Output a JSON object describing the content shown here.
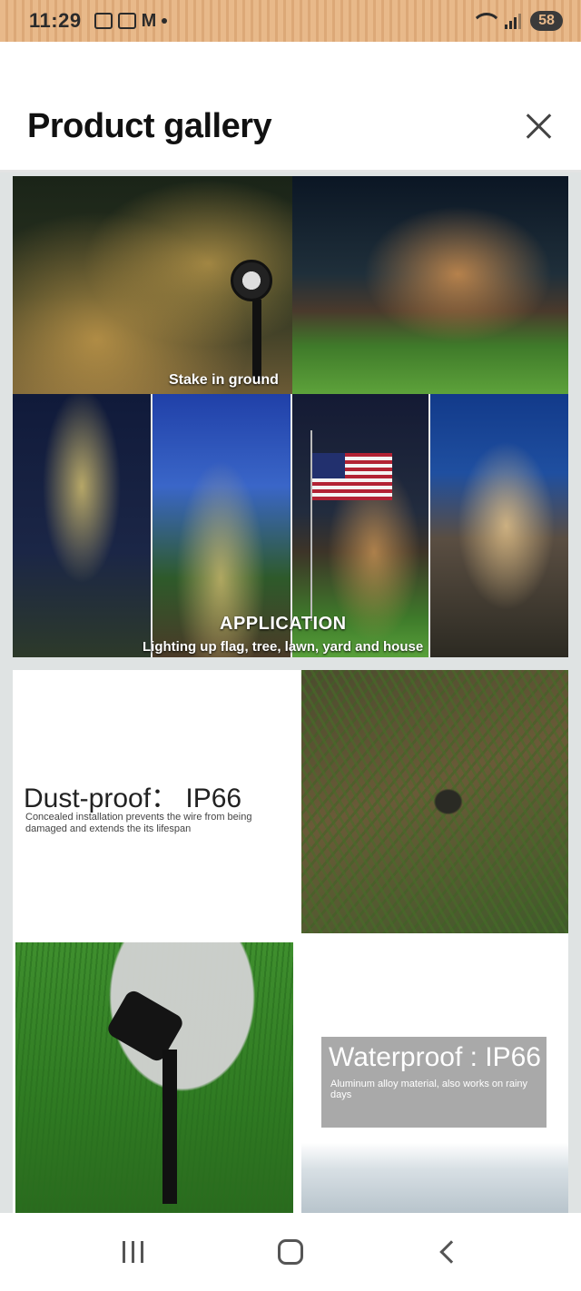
{
  "status_bar": {
    "time": "11:29",
    "mail_glyph": "M",
    "battery": "58",
    "icons": [
      "screenshot-icon",
      "pdf-icon",
      "gmail-icon",
      "dot-icon",
      "wifi-icon",
      "signal-icon",
      "battery-icon"
    ]
  },
  "header": {
    "title": "Product gallery",
    "close_icon": "close-icon"
  },
  "gallery": {
    "image1": {
      "stake_label": "Stake in ground",
      "application_label": "APPLICATION",
      "application_sub": "Lighting up flag, tree, lawn, yard and house"
    },
    "image2": {
      "dust_title": "Dust-proof： IP66",
      "dust_sub": "Concealed installation prevents the wire from being damaged and extends the its lifespan",
      "water_title": "Waterproof : IP66",
      "water_sub": "Aluminum alloy material, also works on rainy days"
    }
  },
  "nav_bar": {
    "buttons": [
      "recent-apps-icon",
      "home-icon",
      "back-icon"
    ]
  },
  "colors": {
    "status_bar_bg": "#e8b98a",
    "title_text": "#111111",
    "gallery_bg": "#dfe3e3"
  }
}
